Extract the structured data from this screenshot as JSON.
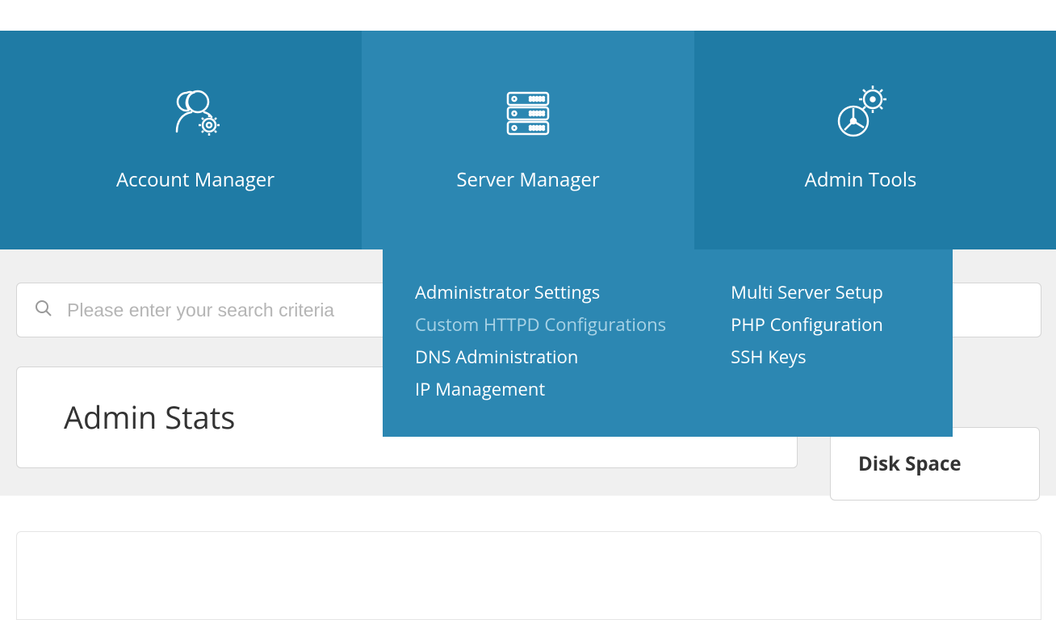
{
  "nav": {
    "items": [
      {
        "label": "Account Manager"
      },
      {
        "label": "Server Manager"
      },
      {
        "label": "Admin Tools"
      }
    ]
  },
  "dropdown": {
    "col1": [
      "Administrator Settings",
      "Custom HTTPD Configurations",
      "DNS Administration",
      "IP Management"
    ],
    "col2": [
      "Multi Server Setup",
      "PHP Configuration",
      "SSH Keys"
    ]
  },
  "search": {
    "placeholder": "Please enter your search criteria"
  },
  "stats": {
    "title": "Admin Stats"
  },
  "side": {
    "title": "Disk Space"
  }
}
